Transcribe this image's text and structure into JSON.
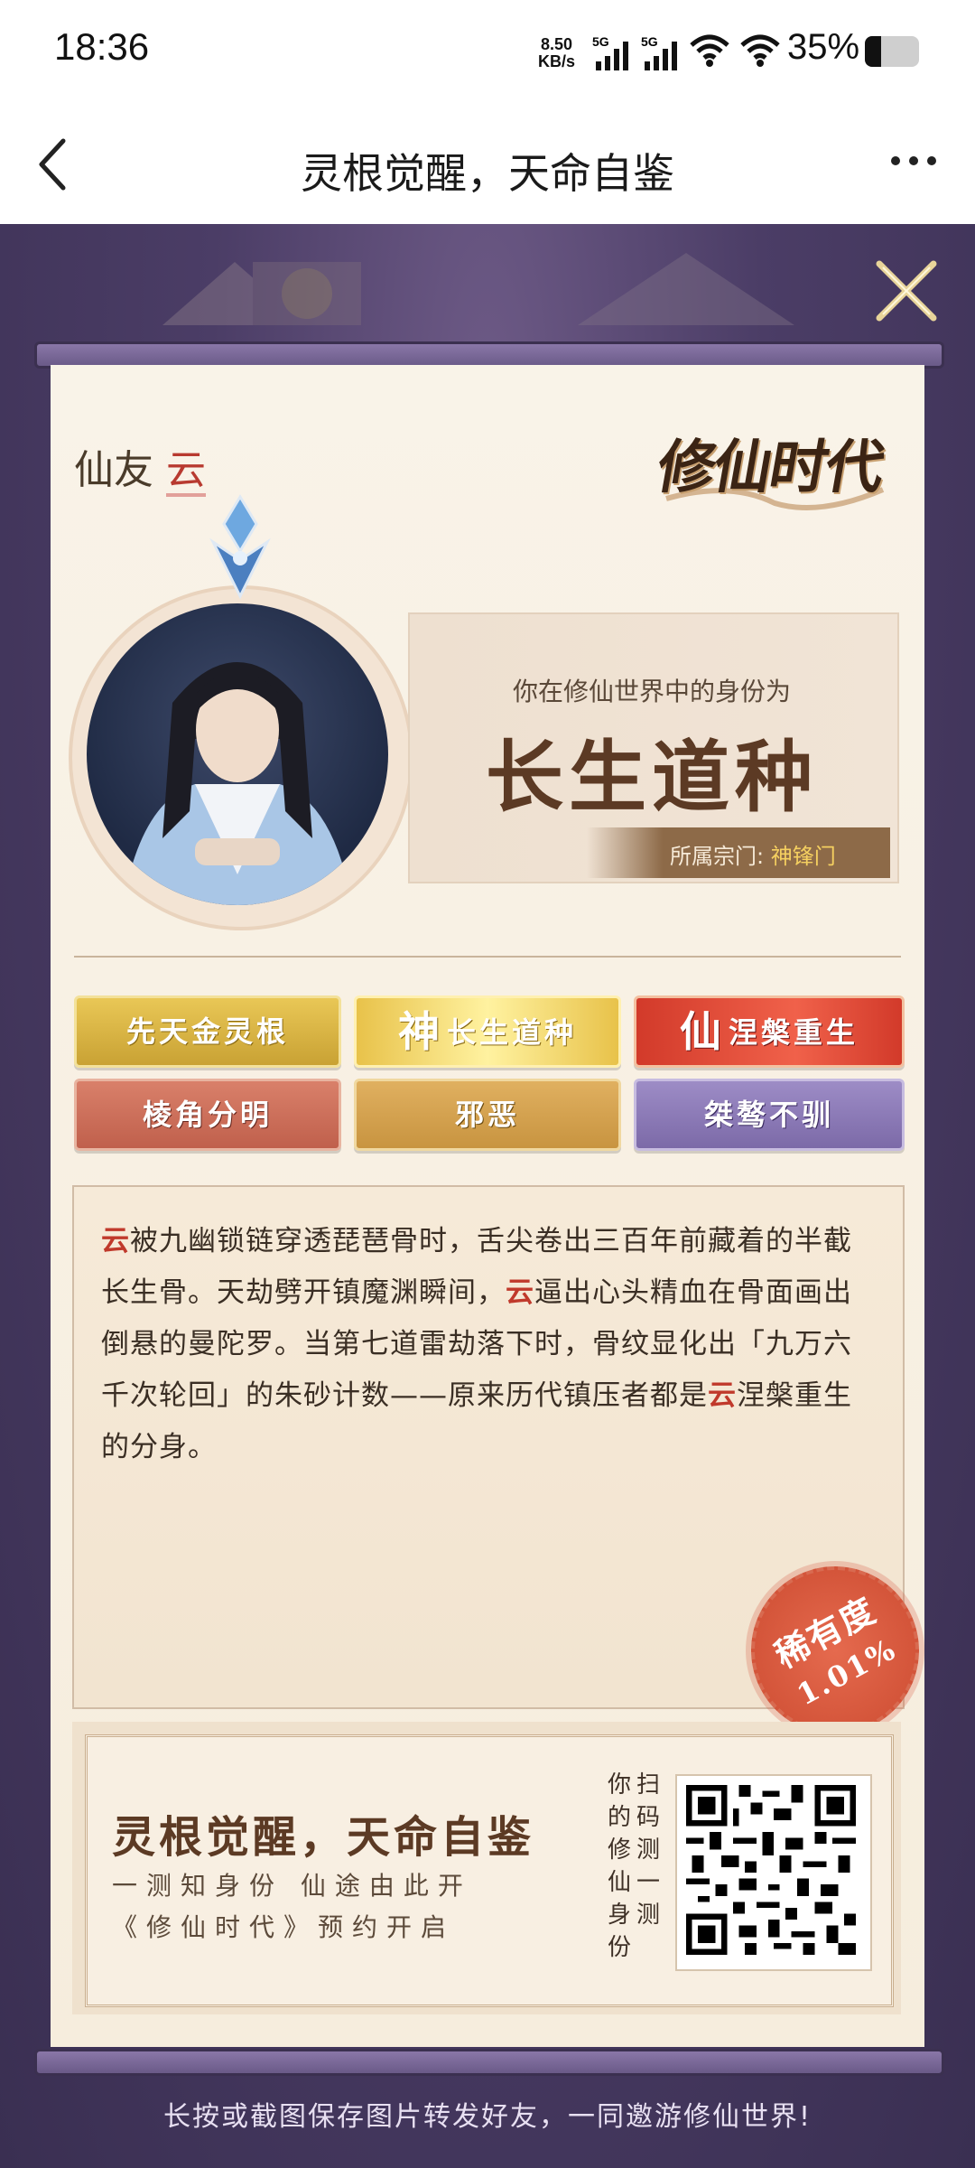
{
  "status_bar": {
    "time": "18:36",
    "net_speed_value": "8.50",
    "net_speed_unit": "KB/s",
    "sim1": "5G",
    "sim2": "5G",
    "battery": "35%"
  },
  "nav": {
    "title": "灵根觉醒，天命自鉴",
    "back_icon": "chevron-left-icon",
    "more_icon": "more-horizontal-icon"
  },
  "card": {
    "friend_label": "仙友",
    "friend_name": "云",
    "game_logo": "修仙时代",
    "identity_prefix": "你在修仙世界中的身份为",
    "identity": "长生道种",
    "sect_label": "所属宗门:",
    "sect_value": "神锋门",
    "tags": [
      {
        "label": "先天金灵根",
        "style": "gold"
      },
      {
        "big": "神",
        "label": "长生道种",
        "style": "brightgold"
      },
      {
        "big": "仙",
        "label": "涅槃重生",
        "style": "red"
      },
      {
        "label": "棱角分明",
        "style": "terracotta"
      },
      {
        "label": "邪恶",
        "style": "ochre"
      },
      {
        "label": "桀骜不驯",
        "style": "purple"
      }
    ],
    "story": [
      {
        "hl": "云",
        "text": "被九幽锁链穿透琵琶骨时，舌尖卷出三百年前藏着的半截长生骨。天劫劈开镇魔渊瞬间，"
      },
      {
        "hl": "云",
        "text": "逼出心头精血在骨面画出倒悬的曼陀罗。当第七道雷劫落下时，骨纹显化出「九万六千次轮回」的朱砂计数——原来历代镇压者都是"
      },
      {
        "hl": "云",
        "text": "涅槃重生的分身。"
      }
    ],
    "rarity_label": "稀有度",
    "rarity_value": "1.01%"
  },
  "promo": {
    "title": "灵根觉醒，天命自鉴",
    "line1": "一测知身份 仙途由此开",
    "line2": "《修仙时代》预约开启",
    "vertical_col1": "你的修仙身份",
    "vertical_col2": "扫码测一测"
  },
  "footer": "长按或截图保存图片转发好友，一同邀游修仙世界!",
  "colors": {
    "accent_red": "#c0392b",
    "brown": "#5c3a24",
    "purple_bg": "#4b3d66",
    "paper": "#f8f1e5"
  }
}
